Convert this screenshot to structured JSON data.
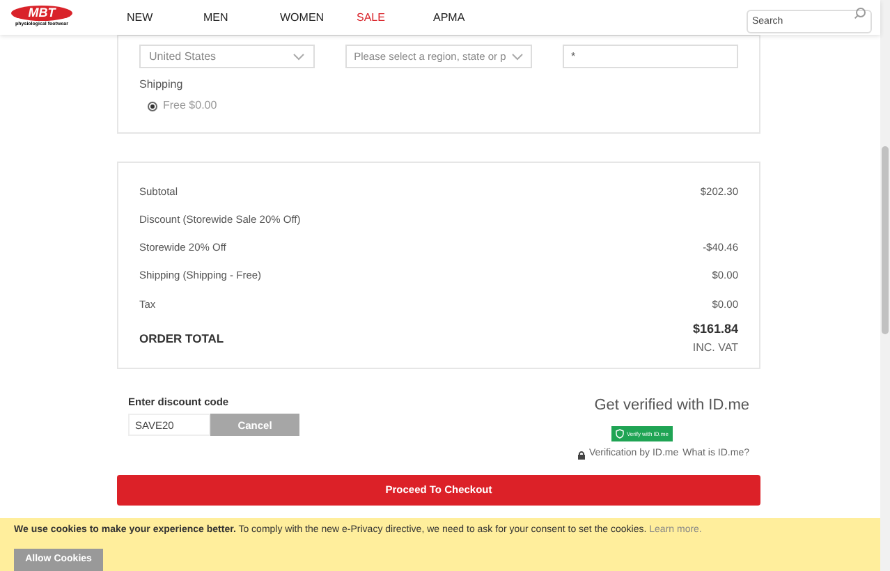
{
  "header": {
    "logo": {
      "brand": "MBT",
      "tagline": "physiological footwear"
    },
    "nav": [
      {
        "label": "NEW",
        "selected": false
      },
      {
        "label": "MEN",
        "selected": false
      },
      {
        "label": "WOMEN",
        "selected": false
      },
      {
        "label": "SALE",
        "selected": true
      },
      {
        "label": "APMA",
        "selected": false
      }
    ],
    "search": {
      "placeholder": "Search"
    }
  },
  "address": {
    "country": "United States",
    "region_placeholder": "Please select a region, state or p",
    "zip": "*"
  },
  "shipping": {
    "label": "Shipping",
    "options": [
      {
        "label": "Free $0.00",
        "selected": true
      }
    ]
  },
  "summary": {
    "rows": [
      {
        "label": "Subtotal",
        "value": "$202.30"
      },
      {
        "label": "Discount (Storewide Sale 20% Off)",
        "value": ""
      },
      {
        "label": "Storewide 20% Off",
        "value": "-$40.46"
      },
      {
        "label": "Shipping (Shipping - Free)",
        "value": "$0.00"
      },
      {
        "label": "Tax",
        "value": "$0.00"
      }
    ],
    "total": {
      "label": "ORDER TOTAL",
      "value": "$161.84",
      "note": "INC. VAT"
    }
  },
  "discount": {
    "label": "Enter discount code",
    "value": "SAVE20",
    "button": "Cancel"
  },
  "idme": {
    "title": "Get verified with ID.me",
    "badge": "Verify with ID.me",
    "note": "Verification by ID.me",
    "link": "What is ID.me?"
  },
  "checkout": "Proceed To Checkout",
  "cookies": {
    "text": "**We use cookies to make your experience better.** To comply with the new e-Privacy directive, we need to ask for your consent to set the cookies.",
    "link": "Learn more.",
    "button": "Allow Cookies"
  }
}
